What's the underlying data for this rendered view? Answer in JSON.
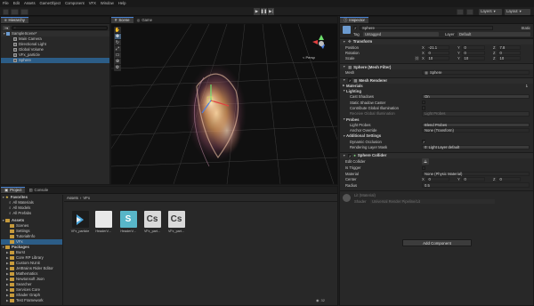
{
  "menubar": [
    "File",
    "Edit",
    "Assets",
    "GameObject",
    "Component",
    "VFX",
    "Window",
    "Help"
  ],
  "toolbar": {
    "play_icon": "play-icon",
    "pause_icon": "pause-icon",
    "step_icon": "step-icon",
    "layers_label": "Layers",
    "layout_label": "Layout"
  },
  "hierarchy": {
    "tab": "Hierarchy",
    "scene": "SampleScene*",
    "items": [
      "Main Camera",
      "Directional Light",
      "Global Volume",
      "VFx_particle",
      "Sphere"
    ],
    "selected_item": "Sphere"
  },
  "scene_view": {
    "tabs": [
      "Scene",
      "Game"
    ],
    "persp_label": "< Persp"
  },
  "project": {
    "tabs": [
      "Project",
      "Console"
    ],
    "favorites_label": "Favorites",
    "favorites": [
      "All Materials",
      "All Models",
      "All Prefabs"
    ],
    "assets_label": "Assets",
    "assets_children": [
      "Scenes",
      "Settings",
      "TutorialInfo",
      "VFx"
    ],
    "packages_label": "Packages",
    "packages": [
      "Burst",
      "Core RP Library",
      "Custom NUnit",
      "JetBrains Rider Editor",
      "Mathematics",
      "Newtonsoft Json",
      "Searcher",
      "Services Core",
      "Shader Graph",
      "Test Framework"
    ],
    "breadcrumb": [
      "Assets",
      "VFx"
    ],
    "files": [
      {
        "label": "VFx_particle",
        "glyph": "vfx-graph-icon",
        "color": "#4aa8e0"
      },
      {
        "label": "HeaderV...",
        "glyph": "",
        "color": "#e8e8e8"
      },
      {
        "label": "HeaderV...",
        "glyph": "S",
        "color": "#58b6c8"
      },
      {
        "label": "VFx_part...",
        "glyph": "Cs",
        "color": "#d9d9d9"
      },
      {
        "label": "VFx_part...",
        "glyph": "Cs",
        "color": "#d9d9d9"
      }
    ]
  },
  "inspector": {
    "tab": "Inspector",
    "object_name": "Sphere",
    "static_label": "Static",
    "tag_label": "Tag",
    "tag_value": "Untagged",
    "layer_label": "Layer",
    "layer_value": "Default",
    "transform": {
      "title": "Transform",
      "position_label": "Position",
      "position": {
        "x": "-21.1",
        "y": "0",
        "z": "7.8"
      },
      "rotation_label": "Rotation",
      "rotation": {
        "x": "0",
        "y": "0",
        "z": "0"
      },
      "scale_label": "Scale",
      "scale": {
        "x": "10",
        "y": "10",
        "z": "10"
      }
    },
    "mesh_filter": {
      "title": "Sphere (Mesh Filter)",
      "mesh_label": "Mesh",
      "mesh_value": "Sphere"
    },
    "mesh_renderer": {
      "title": "Mesh Renderer",
      "materials_label": "Materials",
      "materials_count": "1",
      "lighting_label": "Lighting",
      "cast_shadows_label": "Cast Shadows",
      "cast_shadows_value": "On",
      "static_shadow_caster_label": "Static Shadow Caster",
      "contribute_gi_label": "Contribute Global Illumination",
      "receive_gi_label": "Receive Global Illumination",
      "receive_gi_value": "Light Probes",
      "probes_label": "Probes",
      "light_probes_label": "Light Probes",
      "light_probes_value": "Blend Probes",
      "anchor_override_label": "Anchor Override",
      "anchor_override_value": "None (Transform)",
      "additional_settings_label": "Additional Settings",
      "dynamic_occlusion_label": "Dynamic Occlusion",
      "rendering_layer_mask_label": "Rendering Layer Mask",
      "rendering_layer_mask_value": "0: Light Layer default"
    },
    "sphere_collider": {
      "title": "Sphere Collider",
      "edit_collider_label": "Edit Collider",
      "is_trigger_label": "Is Trigger",
      "material_label": "Material",
      "material_value": "None (Physic Material)",
      "center_label": "Center",
      "center": {
        "x": "0",
        "y": "0",
        "z": "0"
      },
      "radius_label": "Radius",
      "radius_value": "0.5"
    },
    "material": {
      "name": "Lit (Material)",
      "shader_label": "Shader",
      "shader_value": "Universal Render Pipeline/Lit"
    },
    "add_component_label": "Add Component"
  },
  "status": {
    "count": "32"
  }
}
